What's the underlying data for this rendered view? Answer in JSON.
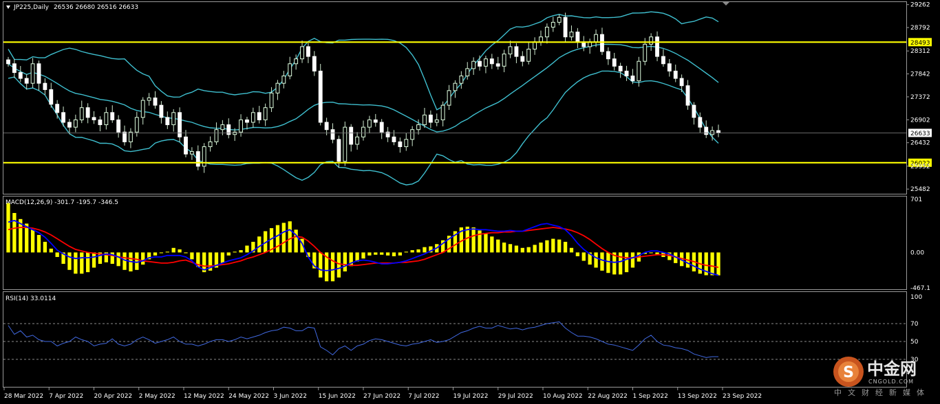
{
  "header": {
    "symbol": "JP225,Daily",
    "ohlc": "26536 26680 26516 26633"
  },
  "watermark": {
    "brand_cn": "中金网",
    "brand_en": "CNGOLD.COM",
    "tagline_cn": "中文财经新媒体",
    "logo_glyph": "S"
  },
  "chart_data": [
    {
      "type": "candlestick",
      "title": "JP225,Daily",
      "y_ticks": [
        "29262",
        "28792",
        "28312",
        "27842",
        "27372",
        "26902",
        "26432",
        "25952",
        "25482"
      ],
      "ylim": [
        25400,
        29300
      ],
      "x_ticks": [
        "28 Mar 2022",
        "7 Apr 2022",
        "20 Apr 2022",
        "2 May 2022",
        "12 May 2022",
        "24 May 2022",
        "3 Jun 2022",
        "15 Jun 2022",
        "27 Jun 2022",
        "7 Jul 2022",
        "19 Jul 2022",
        "29 Jul 2022",
        "10 Aug 2022",
        "22 Aug 2022",
        "1 Sep 2022",
        "13 Sep 2022",
        "23 Sep 2022"
      ],
      "horizontal_lines": [
        {
          "value": 28493,
          "label": "28493",
          "color": "#ffff00"
        },
        {
          "value": 26022,
          "label": "26022",
          "color": "#ffff00"
        }
      ],
      "current_price": {
        "value": 26633,
        "label": "26633"
      },
      "bollinger_color": "#3fbfcf",
      "close": [
        28050,
        27870,
        27750,
        27650,
        28050,
        27650,
        27520,
        27220,
        27050,
        26850,
        26750,
        26900,
        27150,
        26950,
        26900,
        26800,
        27050,
        26900,
        26650,
        26450,
        26650,
        26950,
        27300,
        27350,
        27200,
        26950,
        26800,
        27050,
        26550,
        26200,
        26250,
        25950,
        26350,
        26450,
        26700,
        26800,
        26600,
        26650,
        26900,
        26850,
        27050,
        26900,
        27150,
        27450,
        27650,
        27800,
        28050,
        28150,
        28400,
        28200,
        27900,
        26850,
        26700,
        26500,
        26050,
        26750,
        26400,
        26550,
        26750,
        26900,
        26850,
        26650,
        26550,
        26450,
        26350,
        26500,
        26700,
        26800,
        27000,
        26850,
        26900,
        27200,
        27500,
        27650,
        27800,
        27950,
        28100,
        28000,
        28150,
        28050,
        28000,
        28250,
        28400,
        28200,
        28100,
        28350,
        28500,
        28600,
        28800,
        28900,
        29000,
        28600,
        28700,
        28500,
        28400,
        28500,
        28650,
        28300,
        28150,
        28000,
        27900,
        27800,
        27700,
        28100,
        28450,
        28600,
        28200,
        28050,
        27900,
        27750,
        27600,
        27200,
        26950,
        26750,
        26600,
        26680,
        26633
      ],
      "up_color": "#e0ffe0",
      "down_color": "#ffffff"
    },
    {
      "type": "bar",
      "title": "MACD(12,26,9) -301.7 -195.7 -346.5",
      "y_ticks": [
        "701",
        "0.00",
        "-467.1"
      ],
      "ylim": [
        -467.1,
        701
      ],
      "histogram": [
        650,
        520,
        440,
        380,
        300,
        230,
        140,
        50,
        -60,
        -150,
        -230,
        -280,
        -280,
        -260,
        -200,
        -150,
        -130,
        -150,
        -180,
        -230,
        -250,
        -230,
        -160,
        -90,
        -40,
        -10,
        10,
        60,
        40,
        -10,
        -90,
        -190,
        -260,
        -240,
        -200,
        -140,
        -40,
        10,
        30,
        90,
        140,
        210,
        280,
        320,
        360,
        390,
        410,
        300,
        180,
        -60,
        -210,
        -330,
        -380,
        -380,
        -330,
        -250,
        -180,
        -120,
        -80,
        -40,
        -30,
        -30,
        -40,
        -50,
        -40,
        10,
        30,
        40,
        70,
        80,
        110,
        160,
        220,
        280,
        330,
        340,
        330,
        290,
        250,
        210,
        170,
        130,
        110,
        90,
        60,
        70,
        100,
        130,
        160,
        180,
        170,
        140,
        60,
        -50,
        -110,
        -160,
        -200,
        -240,
        -270,
        -290,
        -290,
        -260,
        -200,
        -120,
        -20,
        -10,
        -30,
        -60,
        -100,
        -140,
        -180,
        -200,
        -250,
        -280,
        -300,
        -300,
        -302
      ],
      "macd": [
        400,
        420,
        380,
        340,
        300,
        260,
        200,
        120,
        30,
        -20,
        -60,
        -80,
        -70,
        -70,
        -60,
        -40,
        -20,
        -30,
        -60,
        -100,
        -120,
        -130,
        -110,
        -70,
        -60,
        -60,
        -40,
        -40,
        -40,
        -60,
        -110,
        -190,
        -230,
        -200,
        -170,
        -140,
        -110,
        -90,
        -70,
        -30,
        20,
        80,
        130,
        180,
        220,
        270,
        300,
        230,
        120,
        -60,
        -180,
        -230,
        -240,
        -230,
        -210,
        -180,
        -140,
        -110,
        -100,
        -110,
        -130,
        -150,
        -150,
        -140,
        -130,
        -110,
        -80,
        -50,
        -20,
        20,
        60,
        120,
        180,
        230,
        280,
        300,
        310,
        300,
        300,
        290,
        280,
        280,
        290,
        280,
        280,
        310,
        340,
        370,
        380,
        360,
        340,
        300,
        220,
        120,
        40,
        -20,
        -70,
        -100,
        -120,
        -130,
        -120,
        -90,
        -70,
        -40,
        0,
        20,
        20,
        0,
        -20,
        -60,
        -100,
        -140,
        -180,
        -220,
        -250,
        -280,
        -302
      ],
      "signal": [
        300,
        320,
        330,
        330,
        320,
        300,
        270,
        230,
        180,
        130,
        80,
        40,
        20,
        0,
        -10,
        -20,
        -30,
        -40,
        -60,
        -70,
        -80,
        -90,
        -110,
        -120,
        -130,
        -140,
        -140,
        -130,
        -110,
        -100,
        -130,
        -160,
        -180,
        -180,
        -170,
        -160,
        -150,
        -130,
        -110,
        -80,
        -60,
        -30,
        0,
        40,
        80,
        130,
        180,
        210,
        200,
        150,
        80,
        0,
        -60,
        -110,
        -150,
        -160,
        -170,
        -170,
        -160,
        -150,
        -140,
        -140,
        -140,
        -140,
        -130,
        -130,
        -120,
        -110,
        -90,
        -60,
        -30,
        0,
        50,
        100,
        150,
        190,
        220,
        240,
        250,
        260,
        260,
        270,
        270,
        280,
        280,
        290,
        300,
        310,
        320,
        330,
        320,
        310,
        290,
        260,
        220,
        170,
        110,
        50,
        0,
        -40,
        -60,
        -70,
        -70,
        -60,
        -50,
        -40,
        -30,
        -30,
        -40,
        -60,
        -80,
        -100,
        -120,
        -150,
        -170,
        -180,
        -196
      ],
      "hist_color": "#ffff00",
      "macd_color": "#0000ff",
      "signal_color": "#ff0000"
    },
    {
      "type": "line",
      "title": "RSI(14) 33.0114",
      "y_ticks": [
        "100",
        "70",
        "50",
        "30"
      ],
      "ylim": [
        0,
        100
      ],
      "levels": [
        70,
        50,
        30
      ],
      "values": [
        68,
        58,
        62,
        55,
        57,
        52,
        50,
        50,
        45,
        48,
        50,
        55,
        52,
        50,
        45,
        47,
        48,
        53,
        47,
        45,
        47,
        52,
        55,
        52,
        48,
        50,
        52,
        55,
        50,
        47,
        47,
        45,
        47,
        50,
        52,
        52,
        50,
        52,
        55,
        53,
        55,
        57,
        60,
        62,
        63,
        66,
        65,
        62,
        62,
        66,
        65,
        44,
        40,
        35,
        42,
        45,
        40,
        45,
        47,
        51,
        53,
        52,
        50,
        48,
        46,
        45,
        47,
        48,
        50,
        52,
        49,
        50,
        52,
        56,
        60,
        62,
        65,
        67,
        65,
        65,
        68,
        66,
        64,
        65,
        63,
        65,
        66,
        68,
        70,
        71,
        72,
        65,
        60,
        56,
        56,
        55,
        53,
        50,
        47,
        46,
        44,
        42,
        40,
        46,
        53,
        57,
        50,
        46,
        45,
        43,
        42,
        40,
        36,
        34,
        32,
        33,
        33.0114
      ],
      "line_color": "#4169e1"
    }
  ]
}
